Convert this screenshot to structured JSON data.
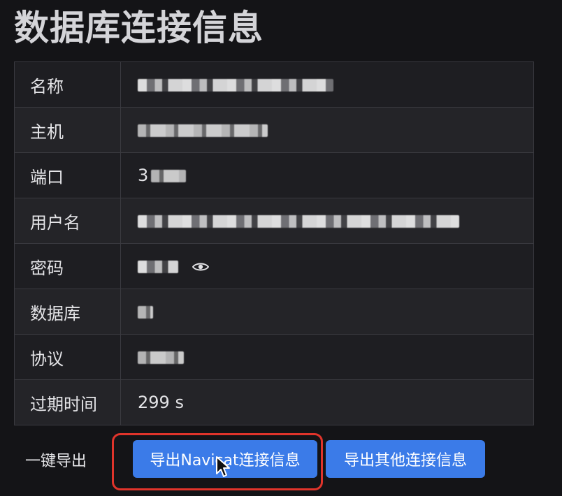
{
  "page": {
    "title": "数据库连接信息"
  },
  "fields": [
    {
      "label": "名称",
      "value": "",
      "masked": true
    },
    {
      "label": "主机",
      "value": "",
      "masked": true
    },
    {
      "label": "端口",
      "value": "3",
      "masked": true
    },
    {
      "label": "用户名",
      "value": "",
      "masked": true
    },
    {
      "label": "密码",
      "value": "",
      "masked": true,
      "icon": "eye-icon"
    },
    {
      "label": "数据库",
      "value": "",
      "masked": true
    },
    {
      "label": "协议",
      "value": "",
      "masked": true
    },
    {
      "label": "过期时间",
      "value": "299 s",
      "masked": false
    }
  ],
  "export": {
    "label": "一键导出",
    "navicat_button": "导出Navicat连接信息",
    "other_button": "导出其他连接信息"
  },
  "colors": {
    "button": "#3b7be8",
    "highlight": "#e0342b",
    "background": "#141417"
  }
}
